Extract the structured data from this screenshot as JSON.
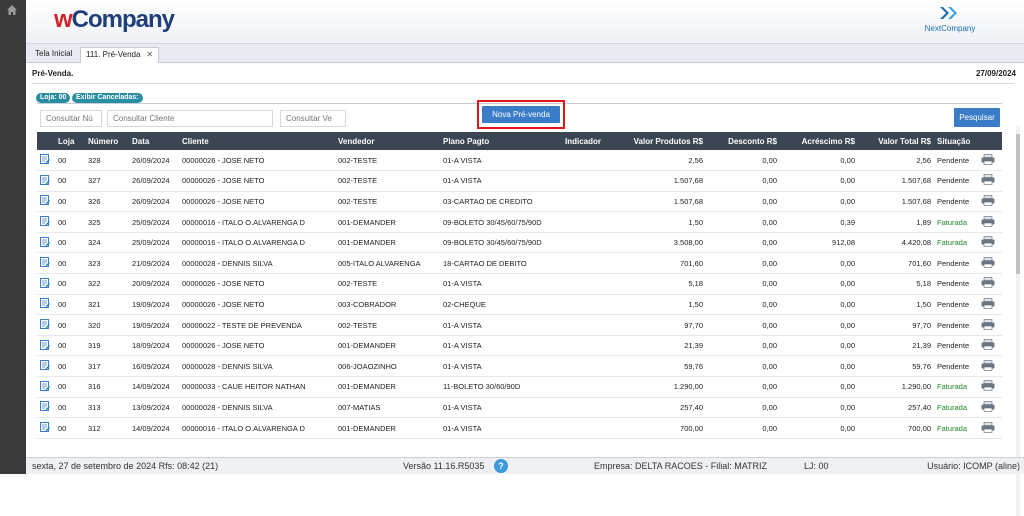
{
  "sidebar": {
    "home_icon": "home-icon"
  },
  "header": {
    "logo_w": "w",
    "logo_rest": "Company",
    "brand_right": "NextCompany"
  },
  "tabs": [
    {
      "label": "Tela Inicial"
    },
    {
      "label": "111. Pré-Venda",
      "close": "✕"
    }
  ],
  "page": {
    "title": "Pré-Venda.",
    "date": "27/09/2024"
  },
  "filters": {
    "loja": "Loja: 00",
    "cancel": "Exibir Canceladas:"
  },
  "search": {
    "numero_ph": "Consultar Nú",
    "cliente_ph": "Consultar Cliente",
    "vendedor_ph": "Consultar Ve",
    "nova_label": "Nova Pré-venda",
    "pesquisar_label": "Pesquisar"
  },
  "table": {
    "headers": [
      "",
      "Loja",
      "Número",
      "Data",
      "Cliente",
      "Vendedor",
      "Plano Pagto",
      "Indicador",
      "Valor Produtos R$",
      "Desconto R$",
      "Acréscimo R$",
      "Valor Total R$",
      "Situação",
      ""
    ],
    "rows": [
      [
        "00",
        "328",
        "26/09/2024",
        "00000026 - JOSE NETO",
        "002-TESTE",
        "01-A VISTA",
        "",
        "2,56",
        "0,00",
        "0,00",
        "2,56",
        "Pendente"
      ],
      [
        "00",
        "327",
        "26/09/2024",
        "00000026 - JOSE NETO",
        "002-TESTE",
        "01-A VISTA",
        "",
        "1.507,68",
        "0,00",
        "0,00",
        "1.507,68",
        "Pendente"
      ],
      [
        "00",
        "326",
        "26/09/2024",
        "00000026 - JOSE NETO",
        "002-TESTE",
        "03-CARTAO DE CREDITO",
        "",
        "1.507,68",
        "0,00",
        "0,00",
        "1.507,68",
        "Pendente"
      ],
      [
        "00",
        "325",
        "25/09/2024",
        "00000016 - ITALO O.ALVARENGA D",
        "001-DEMANDER",
        "09-BOLETO 30/45/60/75/90D",
        "",
        "1,50",
        "0,00",
        "0,39",
        "1,89",
        "Faturada"
      ],
      [
        "00",
        "324",
        "25/09/2024",
        "00000016 - ITALO O.ALVARENGA D",
        "001-DEMANDER",
        "09-BOLETO 30/45/60/75/90D",
        "",
        "3.508,00",
        "0,00",
        "912,08",
        "4.420,08",
        "Faturada"
      ],
      [
        "00",
        "323",
        "21/09/2024",
        "00000028 - DENNIS SILVA",
        "005-ITALO ALVARENGA",
        "18-CARTAO DE DEBITO",
        "",
        "701,60",
        "0,00",
        "0,00",
        "701,60",
        "Pendente"
      ],
      [
        "00",
        "322",
        "20/09/2024",
        "00000026 - JOSE NETO",
        "002-TESTE",
        "01-A VISTA",
        "",
        "5,18",
        "0,00",
        "0,00",
        "5,18",
        "Pendente"
      ],
      [
        "00",
        "321",
        "19/09/2024",
        "00000026 - JOSE NETO",
        "003-COBRADOR",
        "02-CHEQUE",
        "",
        "1,50",
        "0,00",
        "0,00",
        "1,50",
        "Pendente"
      ],
      [
        "00",
        "320",
        "19/09/2024",
        "00000022 - TESTE DE PREVENDA",
        "002-TESTE",
        "01-A VISTA",
        "",
        "97,70",
        "0,00",
        "0,00",
        "97,70",
        "Pendente"
      ],
      [
        "00",
        "319",
        "18/09/2024",
        "00000026 - JOSE NETO",
        "001-DEMANDER",
        "01-A VISTA",
        "",
        "21,39",
        "0,00",
        "0,00",
        "21,39",
        "Pendente"
      ],
      [
        "00",
        "317",
        "16/09/2024",
        "00000028 - DENNIS SILVA",
        "006-JOAOZINHO",
        "01-A VISTA",
        "",
        "59,76",
        "0,00",
        "0,00",
        "59,76",
        "Pendente"
      ],
      [
        "00",
        "316",
        "14/09/2024",
        "00000033 - CAUE HEITOR NATHAN",
        "001-DEMANDER",
        "11-BOLETO 30/60/90D",
        "",
        "1.290,00",
        "0,00",
        "0,00",
        "1.290,00",
        "Faturada"
      ],
      [
        "00",
        "313",
        "13/09/2024",
        "00000028 - DENNIS SILVA",
        "007-MATIAS",
        "01-A VISTA",
        "",
        "257,40",
        "0,00",
        "0,00",
        "257,40",
        "Faturada"
      ],
      [
        "00",
        "312",
        "14/09/2024",
        "00000016 - ITALO O.ALVARENGA D",
        "001-DEMANDER",
        "01-A VISTA",
        "",
        "700,00",
        "0,00",
        "0,00",
        "700,00",
        "Faturada"
      ]
    ]
  },
  "status": {
    "date": "sexta, 27 de setembro de 2024  Rfs: 08:42 (21)",
    "version": "Versão 11.16.R5035",
    "help": "?",
    "empresa": "Empresa: DELTA RACOES - Filial: MATRIZ",
    "lj": "LJ: 00",
    "usuario": "Usuário: ICOMP (aline)"
  },
  "colors": {
    "header_dark": "#3b4554",
    "button_blue": "#3b7cc9",
    "faturada": "#1f8b24",
    "highlight": "#e0161c",
    "pill": "#2a8ea3"
  }
}
